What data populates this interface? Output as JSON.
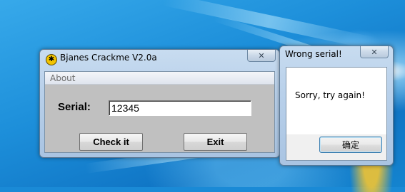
{
  "colors": {
    "desktop": "#1a8ad6",
    "client_gray": "#c0c0c0",
    "titlebar": "#b8d0ea"
  },
  "main_window": {
    "title": "Bjanes Crackme V2.0a",
    "app_icon": "crackme-app-icon",
    "menu": [
      "About"
    ],
    "serial_label": "Serial:",
    "serial_value": "12345",
    "check_button": "Check it",
    "exit_button": "Exit",
    "close_glyph": "✕"
  },
  "message_box": {
    "title": "Wrong serial!",
    "message": "Sorry, try again!",
    "ok_button": "确定",
    "close_glyph": "✕"
  }
}
